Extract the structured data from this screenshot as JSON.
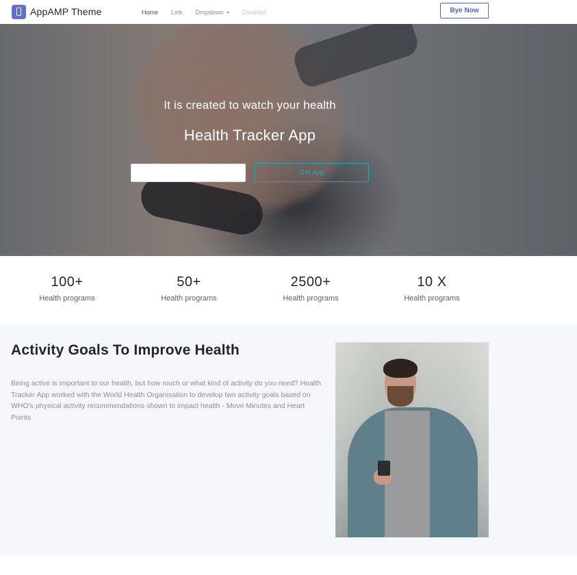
{
  "nav": {
    "brand": "AppAMP Theme",
    "links": [
      {
        "label": "Home",
        "state": "active"
      },
      {
        "label": "Link",
        "state": "normal"
      },
      {
        "label": "Dropdown",
        "state": "normal"
      },
      {
        "label": "Disabled",
        "state": "disabled"
      }
    ],
    "cta": "Bye Now"
  },
  "hero": {
    "subtitle": "It is created to watch your health",
    "title": "Health Tracker App",
    "input_value": "",
    "button": "Get App"
  },
  "stats": [
    {
      "value": "100+",
      "label": "Health programs"
    },
    {
      "value": "50+",
      "label": "Health programs"
    },
    {
      "value": "2500+",
      "label": "Health programs"
    },
    {
      "value": "10 X",
      "label": "Health programs"
    }
  ],
  "activity": {
    "title": "Activity Goals To Improve Health",
    "text": "Being active is important to our health, but how much or what kind of activity do you need? Health Tracker App worked with the World Health Organisation to develop two activity goals based on WHO's physical activity recommendations shown to impact health - Move Minutes and Heart Points"
  },
  "colors": {
    "accent": "#4f63c9",
    "hero_button": "#21a7b0",
    "section_bg": "#f6f7fb"
  },
  "icons": {
    "brand": "phone-icon",
    "dropdown": "caret-down-icon"
  }
}
